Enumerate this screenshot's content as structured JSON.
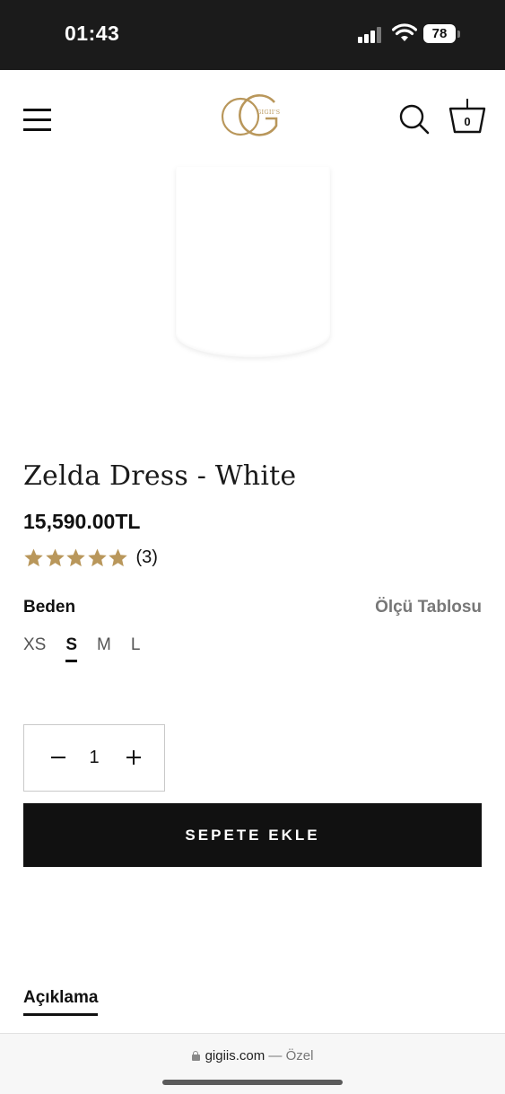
{
  "status_bar": {
    "time": "01:43",
    "battery": "78",
    "icons": [
      "signal-icon",
      "wifi-icon",
      "battery-icon"
    ]
  },
  "header": {
    "menu_icon": "hamburger-menu-icon",
    "logo_text": "GIGII'S",
    "logo_color": "#b9975b",
    "search_icon": "search-icon",
    "cart_icon": "basket-icon",
    "cart_count": "0"
  },
  "product": {
    "title": "Zelda Dress - White",
    "price": "15,590.00TL",
    "rating": {
      "stars": 5,
      "max_stars": 5,
      "count": "(3)",
      "star_color": "#b9975b"
    },
    "size_label": "Beden",
    "size_chart_link": "Ölçü Tablosu",
    "sizes": [
      "XS",
      "S",
      "M",
      "L"
    ],
    "selected_size": "S",
    "quantity": {
      "value": "1",
      "minus_icon": "minus-icon",
      "plus_icon": "plus-icon"
    },
    "add_to_cart_label": "SEPETE EKLE"
  },
  "tabs": {
    "description_label": "Açıklama"
  },
  "browser": {
    "domain": "gigiis.com",
    "mode": "— Özel"
  }
}
